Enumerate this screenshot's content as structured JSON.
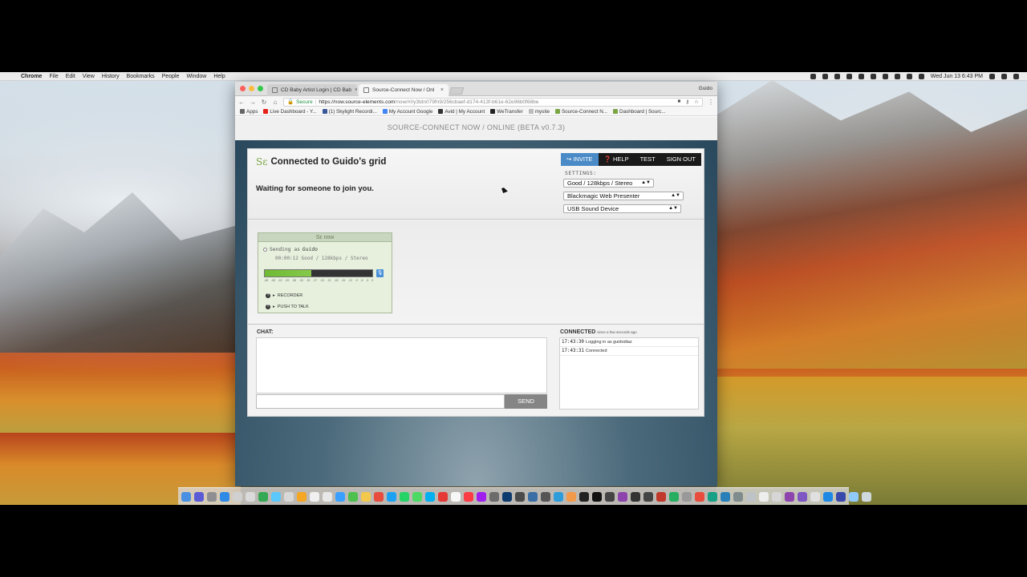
{
  "menubar": {
    "app": "Chrome",
    "items": [
      "File",
      "Edit",
      "View",
      "History",
      "Bookmarks",
      "People",
      "Window",
      "Help"
    ],
    "clock": "Wed Jun 13  6:43 PM"
  },
  "browser": {
    "tabs": [
      {
        "label": "CD Baby Artist Login | CD Bab"
      },
      {
        "label": "Source-Connect Now / Onl"
      }
    ],
    "profile": "Guido",
    "address": {
      "secure_label": "Secure",
      "url_host": "https://now.source-elements.com",
      "url_path": "/now/#!/y3tdn079fn9/256cbaef-d174-413f-b61e-62e96b0f68be"
    },
    "bookmarks": [
      {
        "label": "Apps",
        "color": "#666666"
      },
      {
        "label": "Live Dashboard - Y...",
        "color": "#e62117"
      },
      {
        "label": "(1) Skylight Recordi...",
        "color": "#3b5998"
      },
      {
        "label": "My Account Google",
        "color": "#4285f4"
      },
      {
        "label": "Avid | My Account",
        "color": "#333333"
      },
      {
        "label": "WeTransfer",
        "color": "#222222"
      },
      {
        "label": "mysite",
        "color": "#bbbbbb"
      },
      {
        "label": "Source-Connect N...",
        "color": "#7aa545"
      },
      {
        "label": "Dashboard | Sourc...",
        "color": "#7aa545"
      }
    ]
  },
  "page": {
    "top_title": "SOURCE-CONNECT NOW / ONLINE (BETA v0.7.3)",
    "logo_glyph": "Sε",
    "connected_title": "Connected to Guido's grid",
    "waiting_text": "Waiting for someone to join you.",
    "nav": {
      "invite": "INVITE",
      "help": "HELP",
      "test": "TEST",
      "signout": "SIGN OUT"
    },
    "settings_label": "SETTINGS:",
    "settings": {
      "quality": "Good / 128kbps / Stereo",
      "video": "Blackmagic Web Presenter",
      "audio": "USB Sound Device"
    },
    "peer": {
      "header": "Sε now",
      "sending_prefix": "Sending as",
      "sending_name": "Guido",
      "status_line": "00:00:12   Good / 128kbps / Stereo",
      "meter_level": 0.43,
      "meter_ticks": [
        "-48",
        "-45",
        "-42",
        "-39",
        "-36",
        "-33",
        "-30",
        "-27",
        "-24",
        "-21",
        "-18",
        "-15",
        "-12",
        "-9",
        "-6",
        "-3",
        "0"
      ],
      "recorder": "RECORDER",
      "push_to_talk": "PUSH TO TALK"
    },
    "chat": {
      "label": "CHAT:",
      "send": "SEND",
      "input_value": ""
    },
    "connected": {
      "label": "CONNECTED",
      "since": "since a few seconds ago",
      "log": [
        {
          "time": "17:43:30",
          "text": "Logging in as guidodiaz"
        },
        {
          "time": "17:43:31",
          "text": "Connected"
        }
      ]
    }
  },
  "colors": {
    "invite_blue": "#4a8bc7",
    "meter_green": "#6fba33",
    "logo_green": "#7aa545"
  }
}
